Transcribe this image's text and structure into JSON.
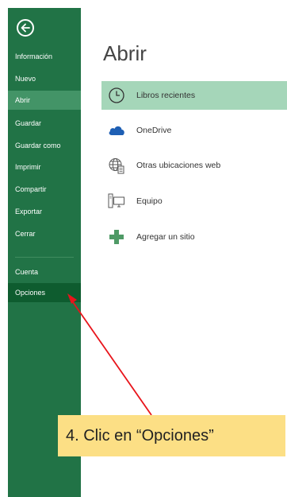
{
  "sidebar": {
    "items": [
      {
        "label": "Información",
        "state": "normal"
      },
      {
        "label": "Nuevo",
        "state": "normal"
      },
      {
        "label": "Abrir",
        "state": "selected"
      },
      {
        "label": "Guardar",
        "state": "normal"
      },
      {
        "label": "Guardar como",
        "state": "normal"
      },
      {
        "label": "Imprimir",
        "state": "normal"
      },
      {
        "label": "Compartir",
        "state": "normal"
      },
      {
        "label": "Exportar",
        "state": "normal"
      },
      {
        "label": "Cerrar",
        "state": "normal"
      }
    ],
    "bottom_items": [
      {
        "label": "Cuenta",
        "state": "normal"
      },
      {
        "label": "Opciones",
        "state": "hover"
      }
    ]
  },
  "main": {
    "title": "Abrir",
    "locations": [
      {
        "label": "Libros recientes",
        "icon": "clock-icon",
        "selected": true
      },
      {
        "label": "OneDrive",
        "icon": "cloud-icon",
        "selected": false
      },
      {
        "label": "Otras ubicaciones web",
        "icon": "globe-icon",
        "selected": false
      },
      {
        "label": "Equipo",
        "icon": "computer-icon",
        "selected": false
      },
      {
        "label": "Agregar un sitio",
        "icon": "plus-icon",
        "selected": false
      }
    ]
  },
  "annotation": {
    "callout_text": "4. Clic en “Opciones”"
  },
  "colors": {
    "sidebar": "#217346",
    "sidebar_selected": "#439467",
    "sidebar_hover": "#0e5c2f",
    "location_selected": "#a5d6b9",
    "callout": "#fcdf85",
    "arrow": "#e8141b"
  }
}
